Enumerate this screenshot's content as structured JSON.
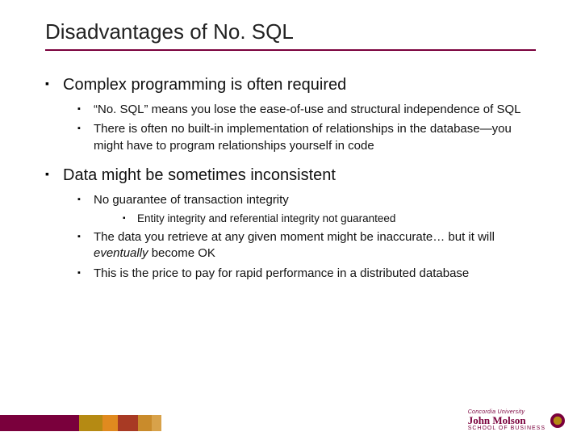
{
  "title": "Disadvantages of No. SQL",
  "bullets": {
    "p1": "Complex programming is often required",
    "p1_1": "“No. SQL” means you lose the ease-of-use and structural independence of SQL",
    "p1_2": "There is often no built-in implementation of relationships in the database—you might have to program relationships yourself in code",
    "p2": "Data might be sometimes inconsistent",
    "p2_1": "No guarantee of transaction integrity",
    "p2_1_1": "Entity integrity and referential integrity not guaranteed",
    "p2_2_a": "The data you retrieve at any given moment might be inaccurate… but it will ",
    "p2_2_em": "eventually",
    "p2_2_b": " become OK",
    "p2_3": "This is the price to pay for rapid performance in a distributed database"
  },
  "logo": {
    "university": "Concordia University",
    "name": "John Molson",
    "sub": "SCHOOL OF BUSINESS"
  }
}
